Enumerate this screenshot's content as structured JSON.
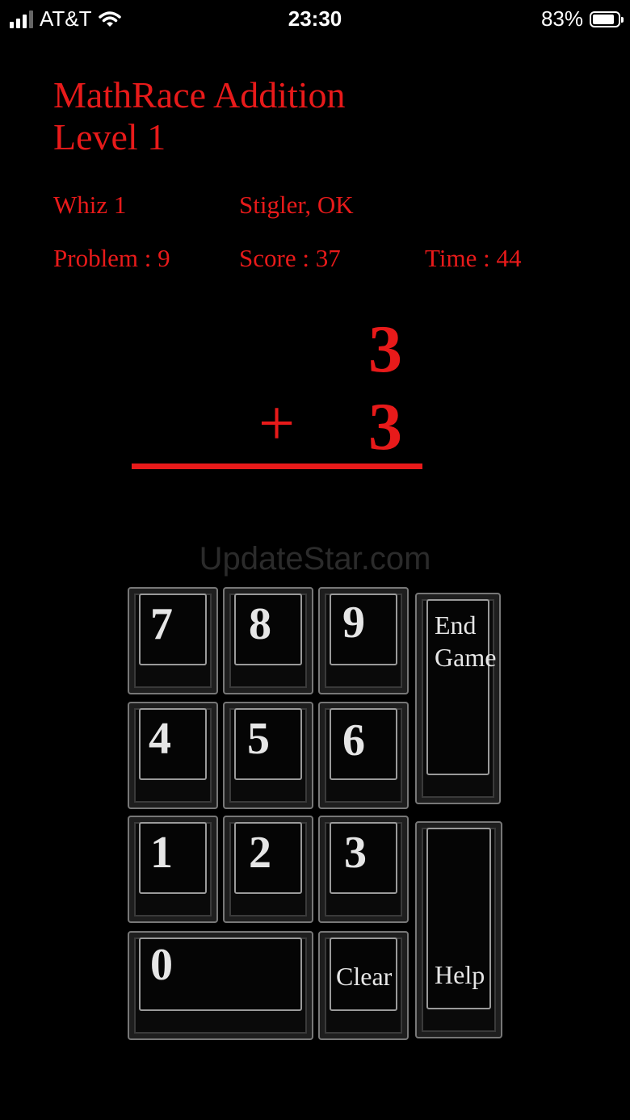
{
  "status_bar": {
    "carrier": "AT&T",
    "time": "23:30",
    "battery_percent": "83%",
    "icons": [
      "signal-icon",
      "wifi-icon",
      "battery-icon"
    ]
  },
  "game": {
    "title": "MathRace Addition",
    "level": "Level 1",
    "player": "Whiz 1",
    "location": "Stigler, OK",
    "problem": "Problem : 9",
    "score": "Score : 37",
    "time": "Time : 44"
  },
  "equation": {
    "top": "3",
    "operator": "+",
    "bottom": "3"
  },
  "watermark": "UpdateStar.com",
  "keypad": {
    "k7": "7",
    "k8": "8",
    "k9": "9",
    "k4": "4",
    "k5": "5",
    "k6": "6",
    "k1": "1",
    "k2": "2",
    "k3": "3",
    "k0": "0",
    "clear": "Clear",
    "end_game_line1": "End",
    "end_game_line2": "Game",
    "help": "Help"
  },
  "colors": {
    "accent": "#e81a1a",
    "background": "#000000",
    "key_text": "#e6e6e6"
  }
}
